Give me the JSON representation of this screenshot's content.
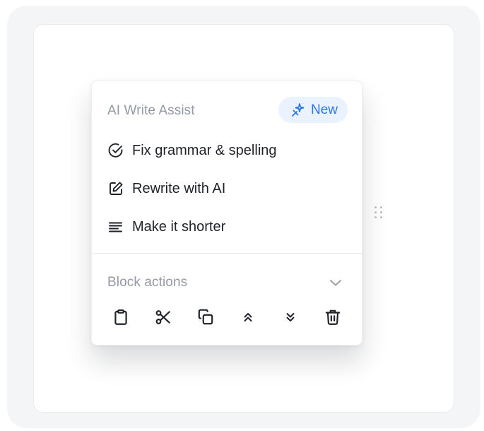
{
  "ai_section": {
    "title": "AI Write Assist",
    "badge": {
      "label": "New",
      "icon": "sparkle-pin-icon",
      "color": "#2a76e8",
      "background": "#eaf3fd"
    },
    "items": [
      {
        "label": "Fix grammar & spelling",
        "icon": "check-circle-icon"
      },
      {
        "label": "Rewrite with AI",
        "icon": "edit-square-icon"
      },
      {
        "label": "Make it shorter",
        "icon": "align-left-lines-icon"
      }
    ]
  },
  "block_section": {
    "title": "Block actions",
    "toggle_icon": "chevron-down-icon",
    "actions": [
      {
        "name": "clipboard",
        "icon": "clipboard-icon"
      },
      {
        "name": "cut",
        "icon": "scissors-icon"
      },
      {
        "name": "duplicate",
        "icon": "copy-icon"
      },
      {
        "name": "move-up",
        "icon": "double-chevron-up-icon"
      },
      {
        "name": "move-down",
        "icon": "double-chevron-down-icon"
      },
      {
        "name": "delete",
        "icon": "trash-icon"
      }
    ]
  },
  "drag_handle_icon": "grip-dots-icon",
  "colors": {
    "text_primary": "#1f2329",
    "text_muted": "#949aa5",
    "accent": "#2a76e8"
  }
}
